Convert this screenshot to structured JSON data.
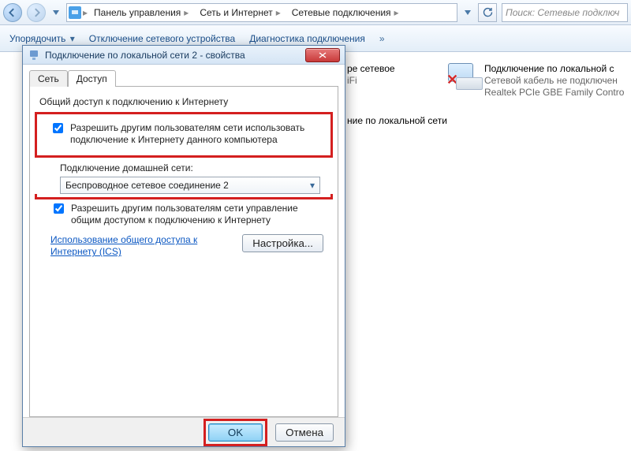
{
  "breadcrumb": {
    "seg1": "Панель управления",
    "seg2": "Сеть и Интернет",
    "seg3": "Сетевые подключения"
  },
  "search": {
    "placeholder": "Поиск: Сетевые подключ"
  },
  "toolbar": {
    "organize": "Упорядочить",
    "disable": "Отключение сетевого устройства",
    "diagnose": "Диагностика подключения"
  },
  "bg": {
    "c1_title_frag": "ре сетевое",
    "c1_sub_frag": "iFi",
    "c2_frag": "ние по локальной сети",
    "c3_title": "Подключение по локальной с",
    "c3_sub": "Сетевой кабель не подключен",
    "c3_dev": "Realtek PCIe GBE Family Contro"
  },
  "dlg": {
    "title": "Подключение по локальной сети 2 - свойства",
    "tab_net": "Сеть",
    "tab_share": "Доступ",
    "group": "Общий доступ к подключению к Интернету",
    "chk1": "Разрешить другим пользователям сети использовать подключение к Интернету данного компьютера",
    "home_label": "Подключение домашней сети:",
    "home_value": "Беспроводное сетевое соединение 2",
    "chk2": "Разрешить другим пользователям сети управление общим доступом к подключению к Интернету",
    "link": "Использование общего доступа к Интернету (ICS)",
    "settings_btn": "Настройка...",
    "ok": "OK",
    "cancel": "Отмена"
  }
}
